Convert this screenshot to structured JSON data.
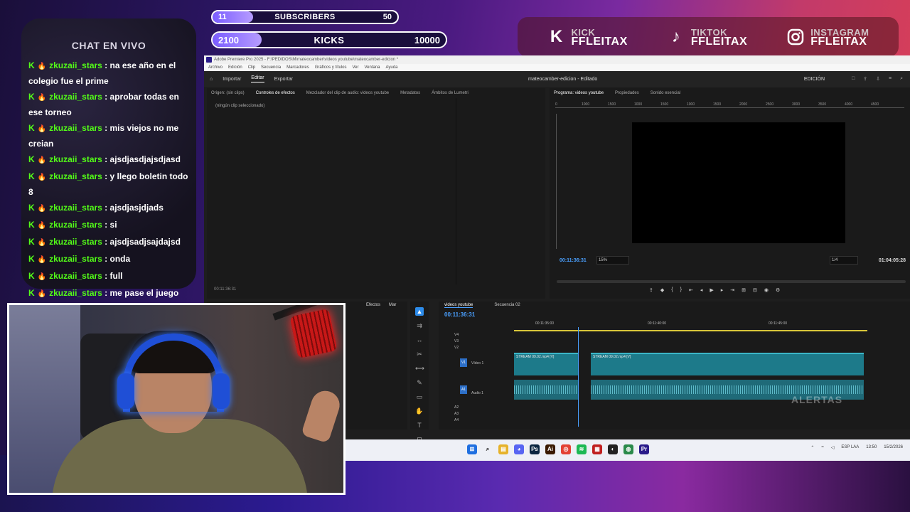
{
  "counters": {
    "subscribers": {
      "current": "11",
      "label": "SUBSCRIBERS",
      "goal": "50",
      "progress": 0.22
    },
    "kicks": {
      "current": "2100",
      "label": "KICKS",
      "goal": "10000",
      "progress": 0.21
    }
  },
  "socials": [
    {
      "platform": "KICK",
      "handle": "FFLEITAX",
      "icon": "kick-logo-icon"
    },
    {
      "platform": "TIKTOK",
      "handle": "FFLEITAX",
      "icon": "tiktok-logo-icon"
    },
    {
      "platform": "INSTAGRAM",
      "handle": "FFLEITAX",
      "icon": "instagram-logo-icon"
    }
  ],
  "chat": {
    "title": "CHAT EN VIVO",
    "messages": [
      {
        "user": "zkuzaii_stars",
        "text": "na ese año en el colegio fue el prime"
      },
      {
        "user": "zkuzaii_stars",
        "text": "aprobar todas en ese torneo"
      },
      {
        "user": "zkuzaii_stars",
        "text": "mis viejos no me creian"
      },
      {
        "user": "zkuzaii_stars",
        "text": "ajsdjasdjajsdjasd"
      },
      {
        "user": "zkuzaii_stars",
        "text": "y llego boletin todo 8"
      },
      {
        "user": "zkuzaii_stars",
        "text": "ajsdjasjdjads"
      },
      {
        "user": "zkuzaii_stars",
        "text": "si"
      },
      {
        "user": "zkuzaii_stars",
        "text": "ajsdjsadjsajdajsd"
      },
      {
        "user": "zkuzaii_stars",
        "text": "onda"
      },
      {
        "user": "zkuzaii_stars",
        "text": "full"
      },
      {
        "user": "zkuzaii_stars",
        "text": "me pase el juego"
      }
    ]
  },
  "premiere": {
    "window_title": "Adobe Premiere Pro 2025 - F:\\PEDIDOS\\M\\mateocamber\\videos youtube\\mateocamber-edicion *",
    "menu": [
      "Archivo",
      "Edición",
      "Clip",
      "Secuencia",
      "Marcadores",
      "Gráficos y títulos",
      "Ver",
      "Ventana",
      "Ayuda"
    ],
    "header_tabs": [
      "Importar",
      "Editar",
      "Exportar"
    ],
    "project_title": "mateocamber-edicion - Editado",
    "workspace": "EDICIÓN",
    "source_tabs": [
      "Origen: (sin clips)",
      "Controles de efectos",
      "Mezclador del clip de audio: videos youtube",
      "Metadatos",
      "Ámbitos de Lumetri"
    ],
    "no_clip": "(ningún clip seleccionado)",
    "source_tc": "00:11:36:31",
    "program_tabs": [
      "Programa: videos youtube",
      "Propiedades",
      "Sonido esencial"
    ],
    "ruler_ticks": [
      "0",
      "1000",
      "1500",
      "1000",
      "1500",
      "1000",
      "1500",
      "2000",
      "2500",
      "3000",
      "3500",
      "4000",
      "4500"
    ],
    "program_tc": "00:11:36:31",
    "zoom": "15%",
    "resolution": "1/4",
    "duration_tc": "01:04:05:28",
    "tools_tabs": [
      "Efectos",
      "Mar"
    ],
    "timeline_tabs": [
      "videos youtube",
      "Secuencia 02"
    ],
    "timeline_tc": "00:11:36:31",
    "timeline_ruler": [
      "00:11:35:00",
      "00:11:40:00",
      "00:11:45:00"
    ],
    "tracks": {
      "v4": "V4",
      "v3": "V3",
      "v2": "V2",
      "v1": "V1",
      "video1": "Vídeo 1",
      "a1": "A1",
      "audio1": "Audio 1",
      "a2": "A2",
      "a3": "A3",
      "a4": "A4"
    },
    "clips": [
      "STREAM 09.02.mp4 [V]",
      "STREAM 09.02.mp4 [V]"
    ],
    "alerts": "ALERTAS"
  },
  "taskbar": {
    "lang": "ESP LAA",
    "time": "13:50",
    "date": "15/2/2026"
  }
}
